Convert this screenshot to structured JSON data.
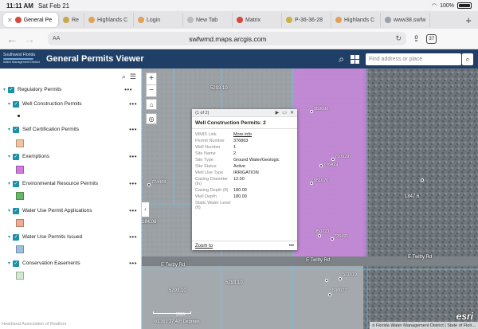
{
  "status": {
    "time": "11:11 AM",
    "date": "Sat Feb 21",
    "battery": "100%"
  },
  "tabs": [
    {
      "label": "General Pe",
      "color": "#d64a3c",
      "active": true
    },
    {
      "label": "Re",
      "color": "#c8a84a"
    },
    {
      "label": "Highlands C",
      "color": "#e0a25a"
    },
    {
      "label": "Login",
      "color": "#e0a25a"
    },
    {
      "label": "New Tab",
      "color": "#bbbbbb"
    },
    {
      "label": "Matrix",
      "color": "#d64a3c"
    },
    {
      "label": "P-36-36-28",
      "color": "#c8b24a"
    },
    {
      "label": "Highlands C",
      "color": "#e0a25a"
    },
    {
      "label": "www38.swfw",
      "color": "#9aa2ad"
    }
  ],
  "browser": {
    "url": "swfwmd.maps.arcgis.com",
    "tab_count": "37",
    "aA": "AA"
  },
  "app": {
    "logo_line1": "Southwest Florida",
    "logo_line2": "Water Management District",
    "title": "General Permits Viewer",
    "search_placeholder": "Find address or place"
  },
  "layers": {
    "root": "Regulatory Permits",
    "items": [
      {
        "label": "Well Construction Permits",
        "swatch": "point"
      },
      {
        "label": "Self Certification Permits",
        "swatch": "#f0c4a0"
      },
      {
        "label": "Exemptions",
        "swatch": "#d27ae0"
      },
      {
        "label": "Environmental Resource Permits",
        "swatch": "#66b866"
      },
      {
        "label": "Water Use Permit Applications",
        "swatch": "#f0aa8e"
      },
      {
        "label": "Water Use Permits Issued",
        "swatch": "#9ec0e0"
      },
      {
        "label": "Conservation Easements",
        "swatch": "#d2ead2"
      }
    ]
  },
  "popup": {
    "pager": "(1 of 2)",
    "title": "Well Construction Permits: 2",
    "rows": [
      {
        "k": "WMIS Link",
        "v": "More info",
        "link": true
      },
      {
        "k": "Permit Number",
        "v": "376863"
      },
      {
        "k": "Well Number",
        "v": "1"
      },
      {
        "k": "Site Name",
        "v": "2"
      },
      {
        "k": "Site Type",
        "v": "Ground Water/Geologic"
      },
      {
        "k": "Site Status",
        "v": "Active"
      },
      {
        "k": "Well Use Type",
        "v": "IRRIGATION"
      },
      {
        "k": "Casing Diameter (in)",
        "v": "12.00"
      },
      {
        "k": "Casing Depth (ft)",
        "v": "180.00"
      },
      {
        "k": "Well Depth",
        "v": "180.00"
      },
      {
        "k": "Static Water Level (ft)",
        "v": ""
      }
    ],
    "zoom": "Zoom to"
  },
  "map": {
    "labels": [
      "5293.10",
      "5293.10",
      "5293.10",
      "E Twitty Rd",
      "E Twitty Rd",
      "E Twitty Rd",
      "864444",
      "184.08",
      "1847.6"
    ],
    "well_ids": [
      "950696",
      "710929",
      "776419",
      "951070",
      "950723",
      "726421",
      "511619",
      "508077",
      "724408"
    ],
    "scale": "200ft",
    "coords": "-81.391 27.40° Degrees",
    "attribution": "n Florida Water Management District | State of Flori..."
  },
  "footer": {
    "text": "Heartland Association of Realtors"
  }
}
